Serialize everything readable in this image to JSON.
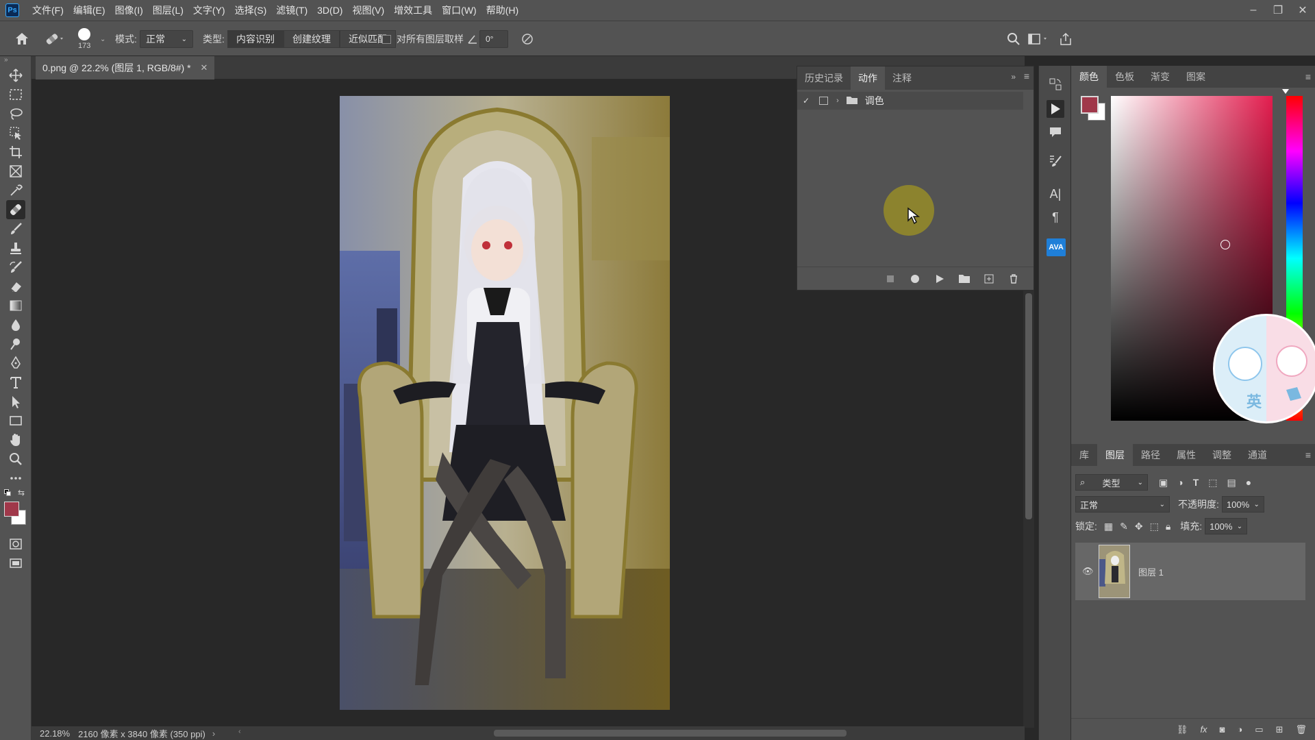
{
  "menubar": {
    "app_icon": "Ps",
    "items": [
      "文件(F)",
      "编辑(E)",
      "图像(I)",
      "图层(L)",
      "文字(Y)",
      "选择(S)",
      "滤镜(T)",
      "3D(D)",
      "视图(V)",
      "增效工具",
      "窗口(W)",
      "帮助(H)"
    ],
    "window_controls": [
      "minimize-icon",
      "restore-icon",
      "close-icon"
    ]
  },
  "options": {
    "brush_size": "173",
    "mode_label": "模式:",
    "mode_value": "正常",
    "type_label": "类型:",
    "type_buttons": [
      "内容识别",
      "创建纹理",
      "近似匹配"
    ],
    "sample_all_layers": "对所有图层取样",
    "angle_value": "0°"
  },
  "document": {
    "tab_title": "0.png @ 22.2% (图层 1, RGB/8#) *",
    "zoom": "22.18%",
    "doc_info": "2160 像素 x 3840 像素 (350 ppi)"
  },
  "actions_panel": {
    "tabs": [
      "历史记录",
      "动作",
      "注释"
    ],
    "active_tab": "动作",
    "action_set": "调色"
  },
  "color_panel": {
    "tabs": [
      "颜色",
      "色板",
      "渐变",
      "图案"
    ],
    "foreground": "#a0384a",
    "background": "#ffffff",
    "badge_text": "英"
  },
  "layers_panel": {
    "tabs": [
      "库",
      "图层",
      "路径",
      "属性",
      "调整",
      "通道"
    ],
    "filter_label": "类型",
    "blend_mode": "正常",
    "opacity_label": "不透明度:",
    "opacity_value": "100%",
    "lock_label": "锁定:",
    "fill_label": "填充:",
    "fill_value": "100%",
    "layers": [
      {
        "name": "图层 1",
        "visible": true
      }
    ]
  },
  "iconcol": {
    "ava_label": "AVA"
  }
}
